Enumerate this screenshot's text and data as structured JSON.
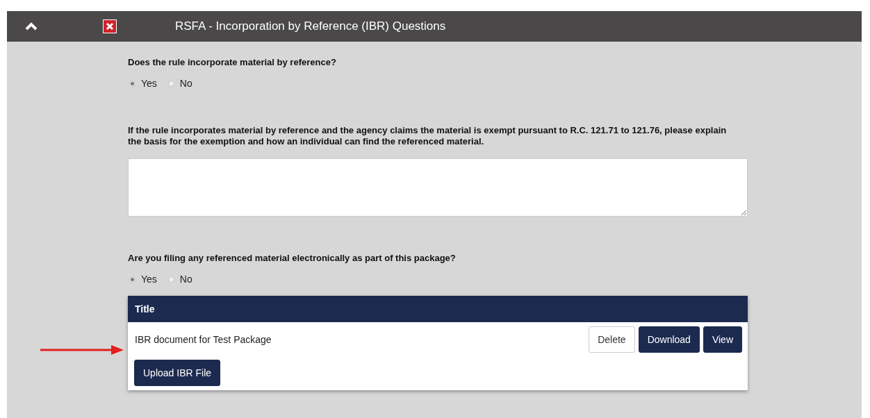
{
  "window": {
    "title": "RSFA - Incorporation by Reference (IBR) Questions"
  },
  "questions": [
    {
      "kind": "radio",
      "label": "Does the rule incorporate material by reference?",
      "options": [
        {
          "label": "Yes",
          "selected": true
        },
        {
          "label": "No",
          "selected": false
        }
      ]
    },
    {
      "kind": "text",
      "label": "If the rule incorporates material by reference and the agency claims the material is exempt pursuant to R.C. 121.71 to 121.76, please explain the basis for the exemption and how an individual can find the referenced material."
    },
    {
      "kind": "radio",
      "label": "Are you filing any referenced material electronically as part of this package?",
      "options": [
        {
          "label": "Yes",
          "selected": true
        },
        {
          "label": "No",
          "selected": false
        }
      ]
    }
  ],
  "table": {
    "columns": [
      "Title"
    ],
    "rows": [
      {
        "title": "IBR document for Test Package",
        "actions": [
          {
            "label": "Delete",
            "kind": "secondary"
          },
          {
            "label": "Download",
            "kind": "primary"
          },
          {
            "label": "View",
            "kind": "primary"
          }
        ]
      }
    ]
  },
  "upload_button": "Upload IBR File"
}
